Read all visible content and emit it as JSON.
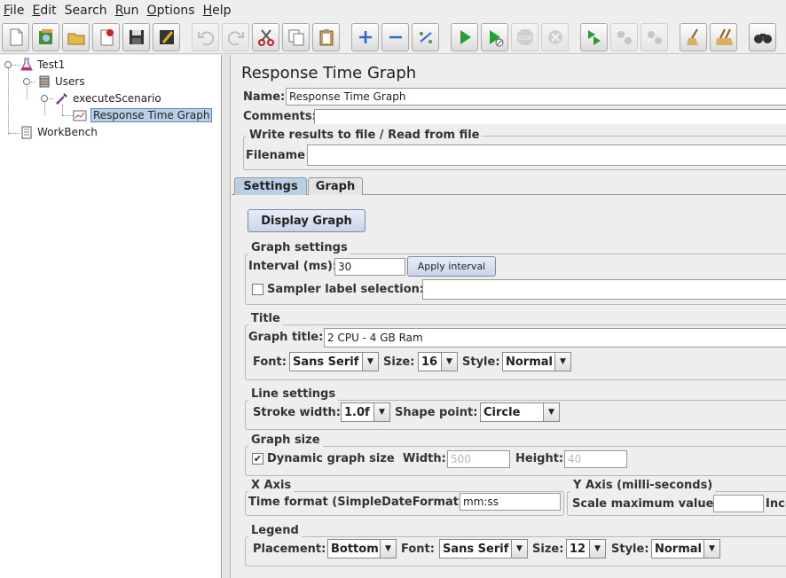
{
  "menubar": {
    "items": [
      {
        "first": "F",
        "rest": "ile"
      },
      {
        "first": "E",
        "rest": "dit"
      },
      {
        "first": "",
        "rest": "Search"
      },
      {
        "first": "R",
        "rest": "un"
      },
      {
        "first": "O",
        "rest": "ptions"
      },
      {
        "first": "H",
        "rest": "elp"
      }
    ]
  },
  "toolbar": {
    "icons": [
      "new-icon",
      "templates-icon",
      "open-icon",
      "close-icon",
      "save-icon",
      "save-as-icon",
      "undo-icon",
      "redo-icon",
      "cut-icon",
      "copy-icon",
      "paste-icon",
      "expand-icon",
      "collapse-icon",
      "toggle-icon",
      "start-icon",
      "start-no-pause-icon",
      "stop-icon",
      "shutdown-icon",
      "remote-start-icon",
      "remote-stop-icon",
      "remote-shutdown-icon",
      "clear-icon",
      "clear-all-icon",
      "search-icon"
    ]
  },
  "tree": {
    "test_plan": "Test1",
    "thread_group": "Users",
    "sampler": "executeScenario",
    "listener": "Response Time Graph",
    "workbench": "WorkBench"
  },
  "main": {
    "title": "Response Time Graph",
    "name_label": "Name:",
    "name_value": "Response Time Graph",
    "comments_label": "Comments:",
    "comments_value": "",
    "file_group_title": "Write results to file / Read from file",
    "filename_label": "Filename",
    "filename_value": ""
  },
  "tabs": {
    "settings": "Settings",
    "graph": "Graph",
    "active": "Settings"
  },
  "settings": {
    "display_graph_button": "Display Graph",
    "graph_settings_title": "Graph settings",
    "interval_label": "Interval (ms):",
    "interval_value": "30",
    "apply_interval_button": "Apply interval",
    "sampler_label_selection": "Sampler label selection:",
    "sampler_label_checked": false,
    "sampler_label_value": "",
    "title_group": "Title",
    "graph_title_label": "Graph title:",
    "graph_title_value": "2 CPU - 4 GB Ram",
    "font_label": "Font:",
    "font_value": "Sans Serif",
    "size_label": "Size:",
    "size_value": "16",
    "style_label": "Style:",
    "style_value": "Normal",
    "line_settings_title": "Line settings",
    "stroke_width_label": "Stroke width:",
    "stroke_width_value": "1.0f",
    "shape_point_label": "Shape point:",
    "shape_point_value": "Circle",
    "graph_size_title": "Graph size",
    "dynamic_graph_size_label": "Dynamic graph size",
    "dynamic_graph_size_checked": true,
    "width_label": "Width:",
    "width_value": "500",
    "height_label": "Height:",
    "height_value": "40",
    "x_axis_title": "X Axis",
    "time_format_label": "Time format (SimpleDateFormat):",
    "time_format_value": "mm:ss",
    "y_axis_title": "Y Axis (milli-seconds)",
    "scale_max_label": "Scale maximum value:",
    "scale_max_value": "",
    "increment_label_partial": "Incr",
    "legend_title": "Legend",
    "placement_label": "Placement:",
    "placement_value": "Bottom",
    "legend_font_label": "Font:",
    "legend_font_value": "Sans Serif",
    "legend_size_label": "Size:",
    "legend_size_value": "12",
    "legend_style_label": "Style:",
    "legend_style_value": "Normal"
  },
  "colors": {
    "selection": "#b8cfe5",
    "button": "#c9d5e8",
    "start_green": "#22a033"
  }
}
